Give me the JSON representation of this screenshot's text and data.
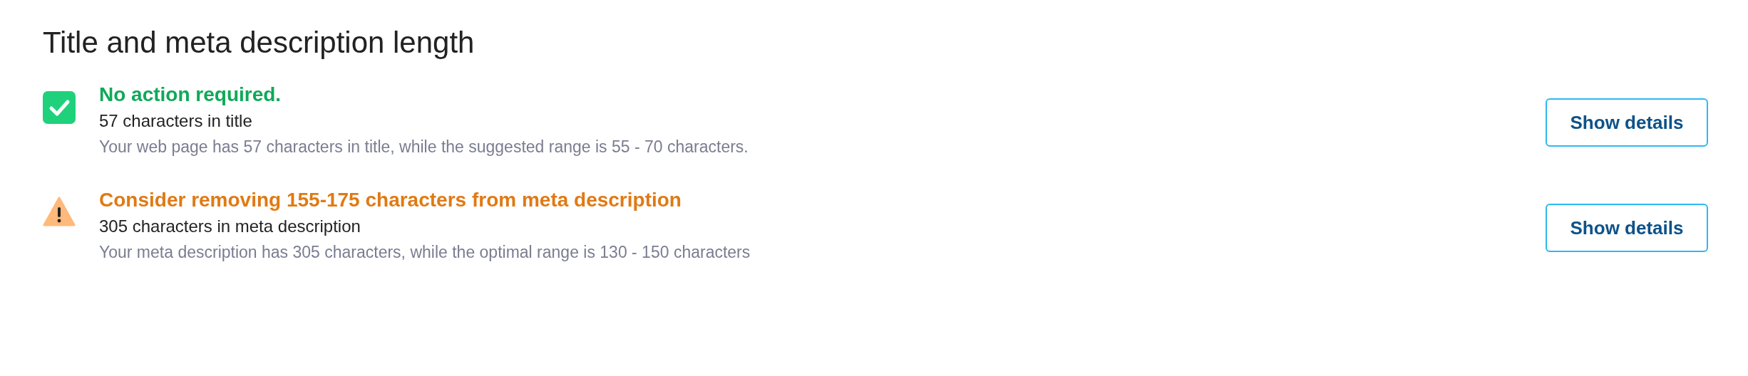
{
  "heading": "Title and meta description length",
  "checks": [
    {
      "kind": "success",
      "headline": "No action required.",
      "summary": "57 characters in title",
      "detail": "Your web page has 57 characters in title, while the suggested range is 55 - 70 characters.",
      "button": "Show details"
    },
    {
      "kind": "warning",
      "headline": "Consider removing 155-175 characters from meta description",
      "summary": "305 characters in meta description",
      "detail": "Your meta description has 305 characters, while the optimal range is 130 - 150 characters",
      "button": "Show details"
    }
  ]
}
